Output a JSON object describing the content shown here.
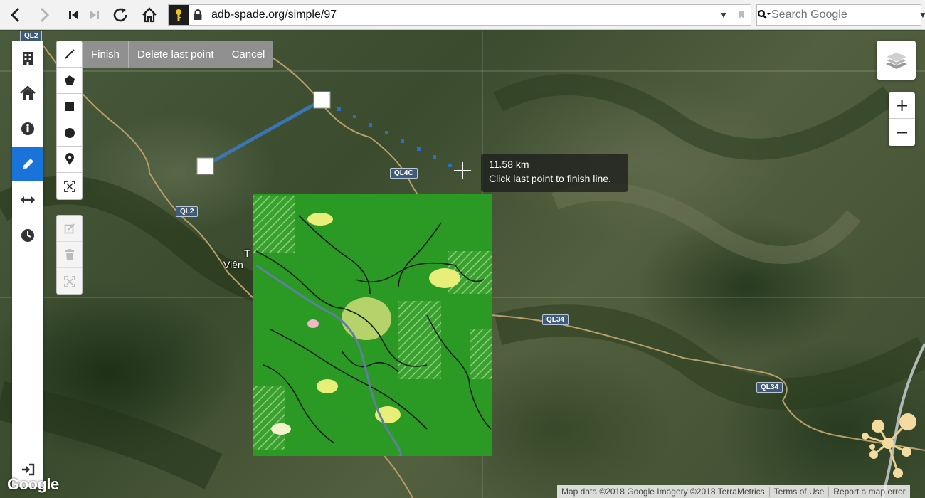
{
  "browser": {
    "url": "adb-spade.org/simple/97",
    "search_placeholder": "Search Google"
  },
  "draw_actions": {
    "finish": "Finish",
    "delete_last_point": "Delete last point",
    "cancel": "Cancel"
  },
  "tooltip": {
    "distance": "11.58 km",
    "hint": "Click last point to finish line."
  },
  "zoom": {
    "in_label": "+",
    "out_label": "−"
  },
  "road_labels": {
    "ql2_top": "QL2",
    "ql2_mid": "QL2",
    "ql4c": "QL4C",
    "ql34_a": "QL34",
    "ql34_b": "QL34"
  },
  "place_labels": {
    "vien": "Viên",
    "t": "T"
  },
  "attribution": {
    "map_data": "Map data ©2018 Google Imagery ©2018 TerraMetrics",
    "terms": "Terms of Use",
    "report": "Report a map error"
  },
  "google_logo": "Google",
  "colors": {
    "overlay_green": "#2a9a24",
    "accent_blue": "#1a73d9",
    "draw_line": "#3a7bc8"
  },
  "icons": {
    "sidebar": [
      "building-icon",
      "home-icon",
      "info-icon",
      "pencil-icon",
      "arrows-horizontal-icon",
      "clock-icon",
      "sign-in-icon"
    ],
    "draw": [
      "polyline-icon",
      "polygon-icon",
      "rectangle-icon",
      "circle-icon",
      "marker-icon",
      "circle-marker-icon"
    ],
    "edit": [
      "edit-layers-icon",
      "trash-icon",
      "fit-icon"
    ]
  }
}
